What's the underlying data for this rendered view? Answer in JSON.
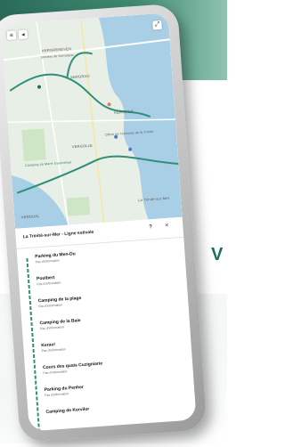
{
  "colors": {
    "brand_green": "#2a6b57",
    "route_teal": "#2f8f7a",
    "map_land": "#e8efe6",
    "map_water": "#a9cfe6"
  },
  "background": {
    "partial_text": "V"
  },
  "map": {
    "labels": {
      "kergreneven": "KERGRENEVEN",
      "kernajor": "Stèdem de Kernarpar",
      "kergrao": "KERGRAO",
      "kerisper": "KERISPER",
      "vergolle": "VERGOLLE",
      "office": "Office de Tourisme de la Trinité",
      "camping": "Camping du Mané Guernehué",
      "kerdual": "KERDUAL",
      "trinite": "La Trinité-sur-Mer"
    },
    "menu_icon": "hamburger-icon",
    "back_icon": "chevron-left-icon",
    "expand_icon": "expand-icon"
  },
  "panel": {
    "title": "La Trinité-sur-Mer - Ligne estivale",
    "help": "?",
    "close": "×",
    "stops": [
      {
        "name": "Parking du Men-Du",
        "info": "Pas d'information"
      },
      {
        "name": "Poulbert",
        "info": "Pas d'information"
      },
      {
        "name": "Camping de la plage",
        "info": "Pas d'information"
      },
      {
        "name": "Camping de la Baie",
        "info": "Pas d'information"
      },
      {
        "name": "Kerau!",
        "info": "Pas d'information"
      },
      {
        "name": "Cours des quais Cuzigniarie",
        "info": "Pas d'information"
      },
      {
        "name": "Parking du Penher",
        "info": "Pas d'information"
      },
      {
        "name": "Camping de Kervilor",
        "info": ""
      }
    ]
  }
}
